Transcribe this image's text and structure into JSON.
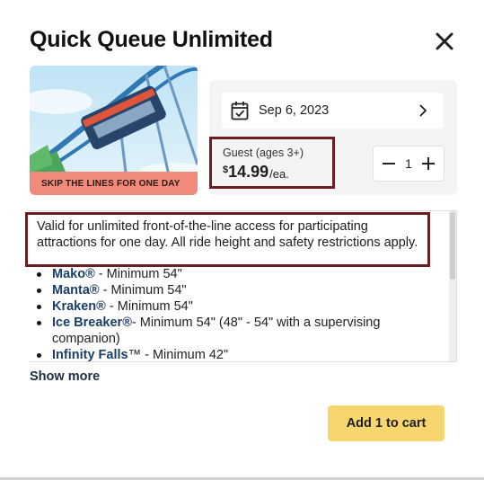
{
  "modal": {
    "title": "Quick Queue Unlimited",
    "close_icon": "close-icon"
  },
  "hero": {
    "badge": "SKIP THE LINES FOR ONE DAY",
    "badge_color": "#f08a7a"
  },
  "date": {
    "icon": "calendar-check-icon",
    "value": "Sep 6, 2023",
    "chevron_icon": "chevron-right-icon"
  },
  "ticket": {
    "label": "Guest (ages 3+)",
    "currency": "$",
    "price": "14.99",
    "unit": "/ea.",
    "quantity": "1",
    "minus_icon": "minus-icon",
    "plus_icon": "plus-icon"
  },
  "description": {
    "text": "Valid for unlimited front-of-the-line access for participating attractions for one day. All ride height and safety restrictions apply."
  },
  "rides": [
    {
      "name": "Mako®",
      "detail": " - Minimum 54\""
    },
    {
      "name": "Manta®",
      "detail": " - Minimum 54\""
    },
    {
      "name": "Kraken®",
      "detail": " - Minimum 54\""
    },
    {
      "name": "Ice Breaker®",
      "detail": "- Minimum 54\" (48\" - 54\" with a supervising companion)"
    },
    {
      "name": "Infinity Falls",
      "detail": "™ - Minimum 42\""
    }
  ],
  "show_more": "Show more",
  "cart_button": "Add 1 to cart",
  "colors": {
    "accent_button": "#f7d66f",
    "highlight_border": "#6b1e22",
    "ride_name": "#1b3f6b"
  }
}
